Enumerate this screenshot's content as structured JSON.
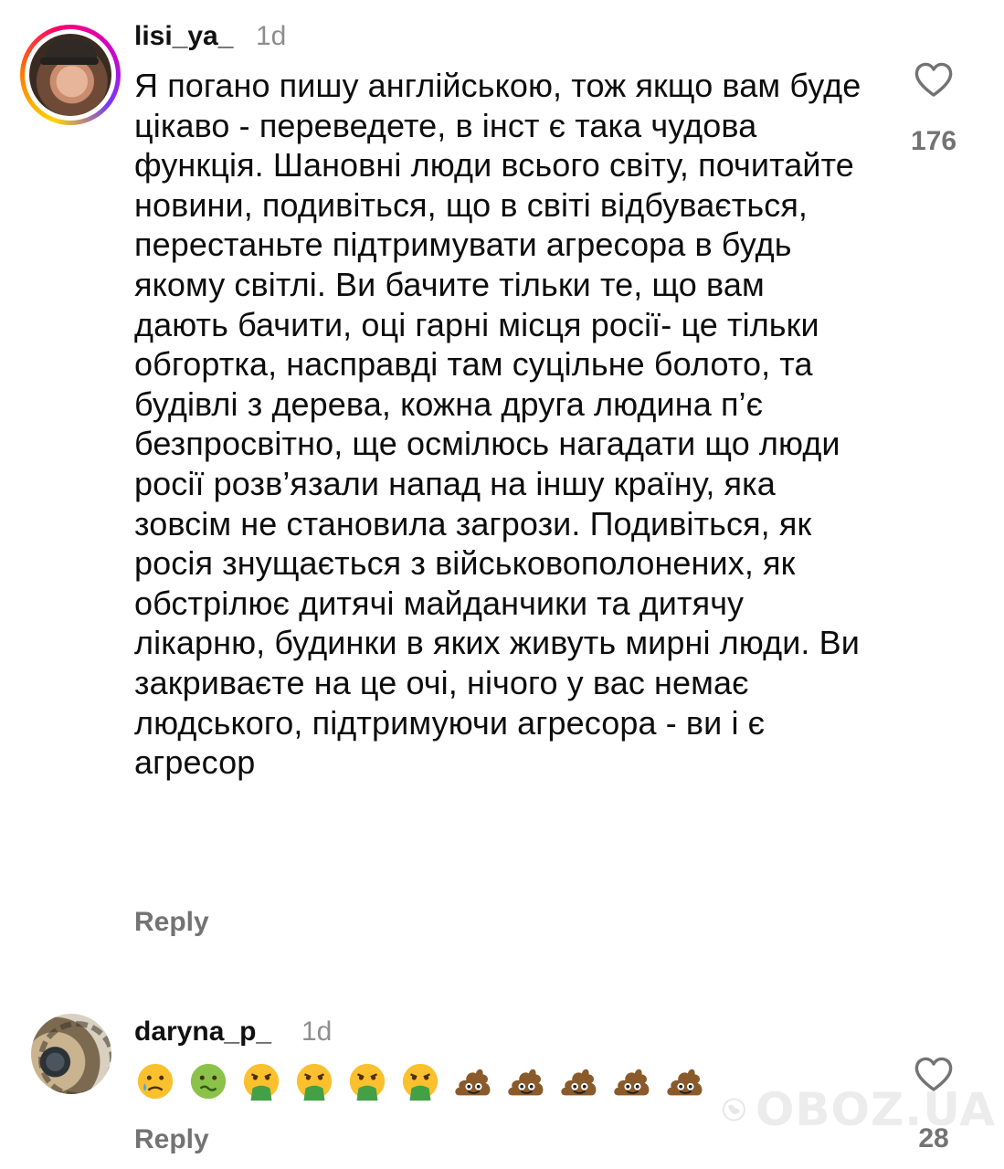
{
  "comments": [
    {
      "username": "lisi_ya_",
      "time": "1d",
      "text": "Я погано пишу англійською, тож якщо вам буде цікаво - переведете, в інст є така чудова функція. Шановні люди всього світу, почитайте новини, подивіться, що в світі відбувається, перестаньте підтримувати агресора в будь якому світлі. Ви бачите тільки те, що вам дають бачити, оці гарні місця росії- це тільки обгортка, насправді там суцільне болото, та будівлі з дерева, кожна друга людина п’є безпросвітно, ще осмілюсь нагадати що люди росії розв’язали напад на іншу країну, яка зовсім не становила загрози. Подивіться, як росія знущається з військовополонених, як обстрілює дитячі майданчики та дитячу лікарню, будинки в яких живуть мирні люди. Ви закриваєте на це очі, нічого у вас немає людського, підтримуючи агресора - ви і є агресор",
      "reply_label": "Reply",
      "likes": "176"
    },
    {
      "username": "daryna_p_",
      "time": "1d",
      "emojis": [
        "😢",
        "🤢",
        "🤮",
        "🤮",
        "🤮",
        "🤮",
        "💩",
        "💩",
        "💩",
        "💩",
        "💩"
      ],
      "reply_label": "Reply",
      "likes": "28"
    }
  ],
  "watermark": "OBOZ.UA",
  "colors": {
    "text": "#0d0d0d",
    "secondary": "#737373",
    "timestamp": "#8e8e8e"
  }
}
